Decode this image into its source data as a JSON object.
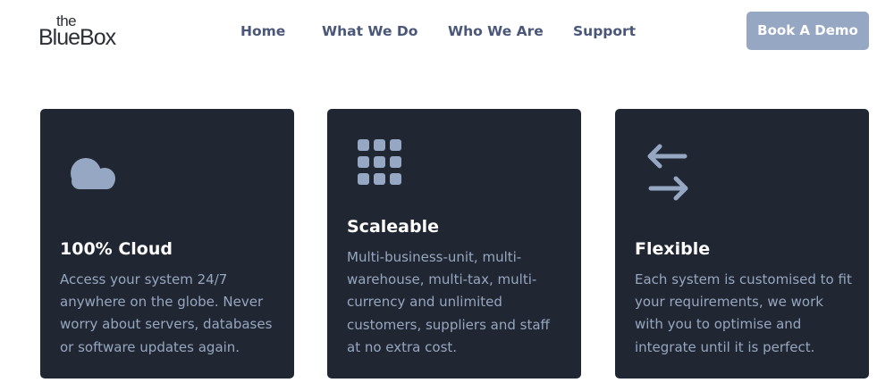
{
  "logo": {
    "top": "the",
    "main": "BlueBox"
  },
  "nav": {
    "home": "Home",
    "what_we_do": "What We Do",
    "who_we_are": "Who We Are",
    "support": "Support"
  },
  "cta": {
    "label": "Book A Demo"
  },
  "colors": {
    "nav_text": "#4b5779",
    "button_bg": "#96a7c3",
    "card_bg": "#202733",
    "card_text": "#97a6bf",
    "icon": "#96a7c3"
  },
  "cards": [
    {
      "icon": "cloud-icon",
      "title": "100% Cloud",
      "lines": [
        "Access your system 24/7",
        "anywhere on the globe. Never",
        "worry about servers, databases",
        "or software updates again."
      ]
    },
    {
      "icon": "grid-icon",
      "title": "Scaleable",
      "lines": [
        "Multi-business-unit, multi-",
        "warehouse, multi-tax, multi-",
        "currency and unlimited",
        "customers, suppliers and staff",
        "at no extra cost."
      ]
    },
    {
      "icon": "exchange-arrows-icon",
      "title": "Flexible",
      "lines": [
        "Each system is customised to fit",
        "your requirements, we work",
        "with you to optimise and",
        "integrate until it is perfect."
      ]
    }
  ]
}
